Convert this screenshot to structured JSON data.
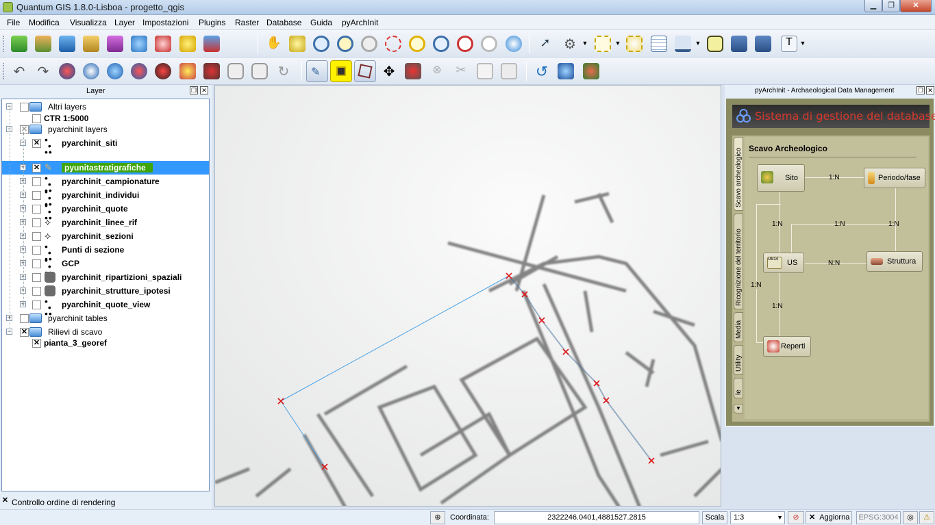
{
  "window": {
    "title": "Quantum GIS 1.8.0-Lisboa - progetto_qgis"
  },
  "menubar": [
    "File",
    "Modifica",
    "Visualizza",
    "Layer",
    "Impostazioni",
    "Plugins",
    "Raster",
    "Database",
    "Guida",
    "pyArchInit"
  ],
  "layer_panel": {
    "title": "Layer",
    "render_order_label": "Controllo ordine di rendering",
    "rows": [
      {
        "label": "Altri layers",
        "check": "unchecked",
        "icon": "folder-icon"
      },
      {
        "label": "CTR 1:5000",
        "check": "unchecked",
        "icon": "none"
      },
      {
        "label": "pyarchinit layers",
        "check": "partial",
        "icon": "folder-icon"
      },
      {
        "label": "pyarchinit_siti",
        "check": "checked",
        "icon": "point-icon"
      },
      {
        "label": "pyunitastratigrafiche",
        "check": "checked",
        "icon": "pencil-icon",
        "selected": true
      },
      {
        "label": "pyarchinit_campionature",
        "check": "unchecked",
        "icon": "point-icon"
      },
      {
        "label": "pyarchinit_individui",
        "check": "unchecked",
        "icon": "point-icon"
      },
      {
        "label": "pyarchinit_quote",
        "check": "unchecked",
        "icon": "point-icon"
      },
      {
        "label": "pyarchinit_linee_rif",
        "check": "unchecked",
        "icon": "line-icon"
      },
      {
        "label": "pyarchinit_sezioni",
        "check": "unchecked",
        "icon": "line-icon"
      },
      {
        "label": "Punti di sezione",
        "check": "unchecked",
        "icon": "point-icon"
      },
      {
        "label": "GCP",
        "check": "unchecked",
        "icon": "point-icon"
      },
      {
        "label": "pyarchinit_ripartizioni_spaziali",
        "check": "unchecked",
        "icon": "polygon-icon"
      },
      {
        "label": "pyarchinit_strutture_ipotesi",
        "check": "unchecked",
        "icon": "polygon-icon"
      },
      {
        "label": "pyarchinit_quote_view",
        "check": "unchecked",
        "icon": "point-icon"
      },
      {
        "label": "pyarchinit tables",
        "check": "unchecked",
        "icon": "folder-icon"
      },
      {
        "label": "Rilievi di scavo",
        "check": "checked",
        "icon": "folder-icon"
      },
      {
        "label": "pianta_3_georef",
        "check": "checked",
        "icon": "none"
      }
    ]
  },
  "pyarchinit": {
    "panel_title": "pyArchInit - Archaeological Data Management",
    "banner": "Sistema di gestione del database",
    "tabs": [
      "Scavo archeologico",
      "Ricognizione del territorio",
      "Media",
      "Utility",
      "le"
    ],
    "section_title": "Scavo Archeologico",
    "nodes": {
      "sito": "Sito",
      "periodo": "Periodo/fase",
      "us": "US",
      "struttura": "Struttura",
      "reperti": "Reperti"
    },
    "relations": {
      "sito_periodo": "1:N",
      "sito_us": "1:N",
      "us_periodo": "1:N",
      "periodo_struttura": "1:N",
      "us_struttura": "N:N",
      "us_reperti": "1:N",
      "left_loop": "1:N"
    },
    "us_icon_text": "US14"
  },
  "statusbar": {
    "coord_label": "Coordinata:",
    "coord_value": "2322246.0401,4881527.2815",
    "scale_label": "Scala",
    "scale_value": "1:3",
    "render_label": "Aggiorna",
    "epsg": "EPSG:3004"
  },
  "map_sketch": {
    "note": "hand-drawn excavation plan raster with digitizing vertices"
  },
  "colors": {
    "selection": "#3399ff",
    "highlight": "#3ea60c",
    "banner_text": "#d8382d",
    "vertex": "#e01818",
    "digitize_line": "#4aa3e6"
  }
}
